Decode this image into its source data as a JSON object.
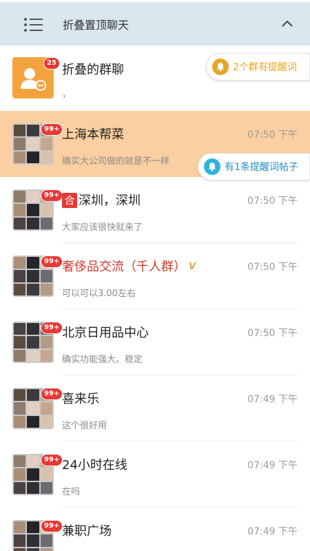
{
  "header": {
    "title": "折叠置顶聊天"
  },
  "folded_group": {
    "title": "折叠的群聊",
    "preview": "，",
    "badge": "25",
    "pill_text": "2个群有提醒词",
    "avatar_color": "#f3a33d",
    "pill_color": "#e8a523"
  },
  "chats": [
    {
      "title": "上海本帮菜",
      "preview": "确实大公司做的就是不一样",
      "time": "07:50 下午",
      "badge": "99+",
      "highlighted": true,
      "pill_text": "有1条提醒词帖子"
    },
    {
      "tag": "合",
      "title": "深圳，深圳",
      "preview": "大家应该很快就来了",
      "time": "07:50 下午",
      "badge": "99+"
    },
    {
      "title": "奢侈品交流（千人群）",
      "vip": "V",
      "preview": "可以可以3.00左右",
      "time": "07:50 下午",
      "badge": "99+",
      "red_title": true
    },
    {
      "title": "北京日用品中心",
      "preview": "确实功能强大。稳定",
      "time": "07:50 下午",
      "badge": "99+"
    },
    {
      "title": "喜来乐",
      "preview": "这个很好用",
      "time": "07:49 下午",
      "badge": "99+"
    },
    {
      "title": "24小时在线",
      "preview": "在吗",
      "time": "07:49 下午",
      "badge": "99+"
    },
    {
      "title": "兼职广场",
      "preview": "...",
      "time": "07:49 下午",
      "badge": "99+"
    }
  ],
  "colors": {
    "header_bg": "#d9e7ef",
    "highlight_bg": "#fbcfa1",
    "badge_red": "#e53935",
    "title_red": "#d0392b",
    "pill_blue": "#2bb3e0"
  }
}
